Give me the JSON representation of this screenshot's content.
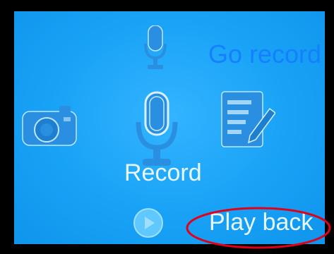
{
  "screen": {
    "menu": {
      "go_record_label": "Go record",
      "record_label": "Record",
      "play_back_label": "Play back"
    },
    "icons": {
      "top_mic": "microphone-icon",
      "camera": "camera-icon",
      "main_mic": "microphone-icon",
      "notes": "notepad-pencil-icon",
      "play": "play-icon"
    },
    "colors": {
      "screen_bg": "#18a2f6",
      "accent_text": "#1580ff",
      "icon": "#2a8fe0",
      "label_text": "#e8f6ff",
      "annotation": "#e0001a"
    }
  }
}
